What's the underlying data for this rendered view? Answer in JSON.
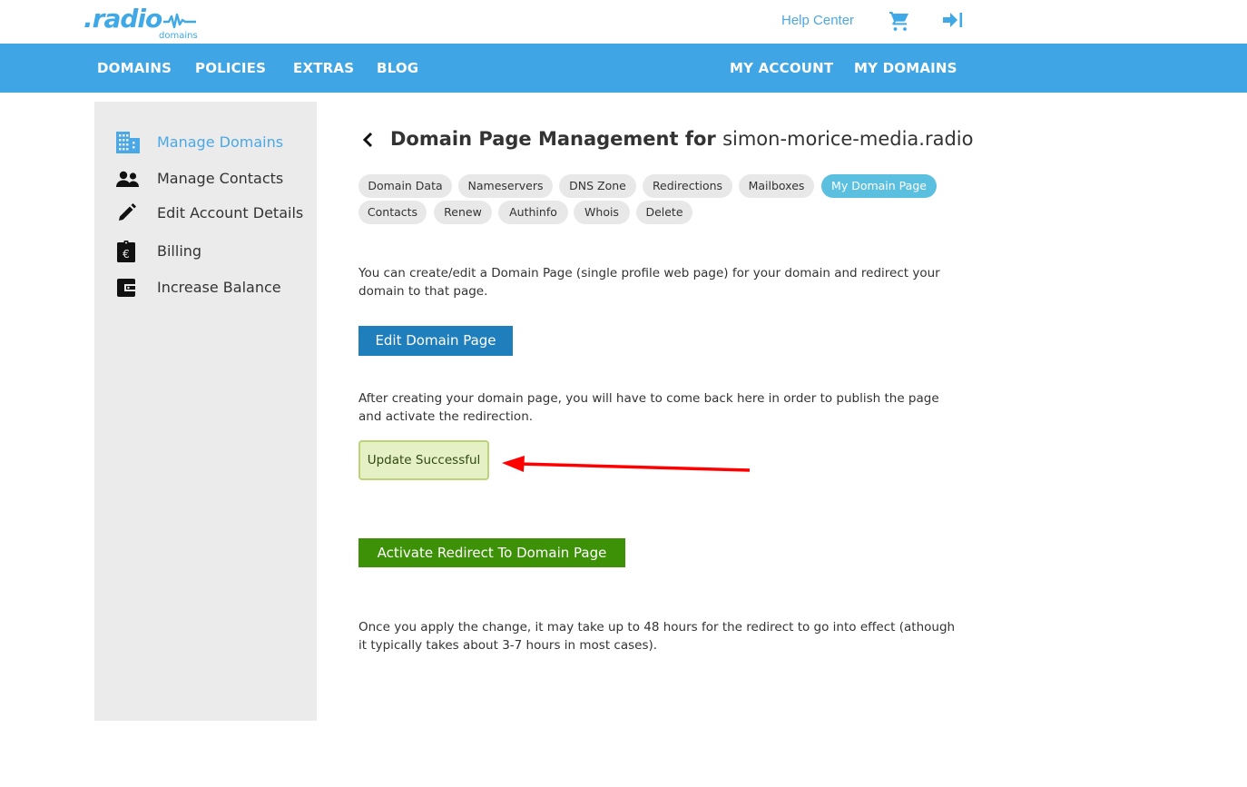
{
  "header": {
    "logo": {
      "main": ".radio",
      "sub": "domains"
    },
    "help_center": "Help Center",
    "icons": {
      "cart": "shopping-cart-icon",
      "logout": "logout-icon"
    },
    "brand_color": "#3fa5e5"
  },
  "nav": {
    "left": [
      "DOMAINS",
      "POLICIES",
      "EXTRAS",
      "BLOG"
    ],
    "right": [
      "MY ACCOUNT",
      "MY DOMAINS"
    ]
  },
  "sidebar": {
    "items": [
      {
        "label": "Manage Domains",
        "icon": "building-icon",
        "active": true
      },
      {
        "label": "Manage Contacts",
        "icon": "people-icon",
        "active": false
      },
      {
        "label": "Edit Account Details",
        "icon": "pencil-icon",
        "active": false
      },
      {
        "label": "Billing",
        "icon": "euro-receipt-icon",
        "active": false
      },
      {
        "label": "Increase Balance",
        "icon": "wallet-icon",
        "active": false
      }
    ]
  },
  "main": {
    "title_prefix": "Domain Page Management for ",
    "domain": "simon-morice-media.radio",
    "tabs": [
      {
        "label": "Domain Data",
        "active": false
      },
      {
        "label": "Nameservers",
        "active": false
      },
      {
        "label": "DNS Zone",
        "active": false
      },
      {
        "label": "Redirections",
        "active": false
      },
      {
        "label": "Mailboxes",
        "active": false
      },
      {
        "label": "My Domain Page",
        "active": true
      },
      {
        "label": "Contacts",
        "active": false
      },
      {
        "label": "Renew",
        "active": false
      },
      {
        "label": "Authinfo",
        "active": false
      },
      {
        "label": "Whois",
        "active": false
      },
      {
        "label": "Delete",
        "active": false
      }
    ],
    "intro": "You can create/edit a Domain Page (single profile web page) for your domain and redirect your domain to that page.",
    "edit_button": "Edit Domain Page",
    "after_note": "After creating your domain page, you will have to come back here in order to publish the page and activate the redirection.",
    "status_message": "Update Successful",
    "activate_button": "Activate Redirect To Domain Page",
    "footer_note": "Once you apply the change, it may take up to 48 hours for the redirect to go into effect (athough it typically takes about 3-7 hours in most cases)."
  }
}
